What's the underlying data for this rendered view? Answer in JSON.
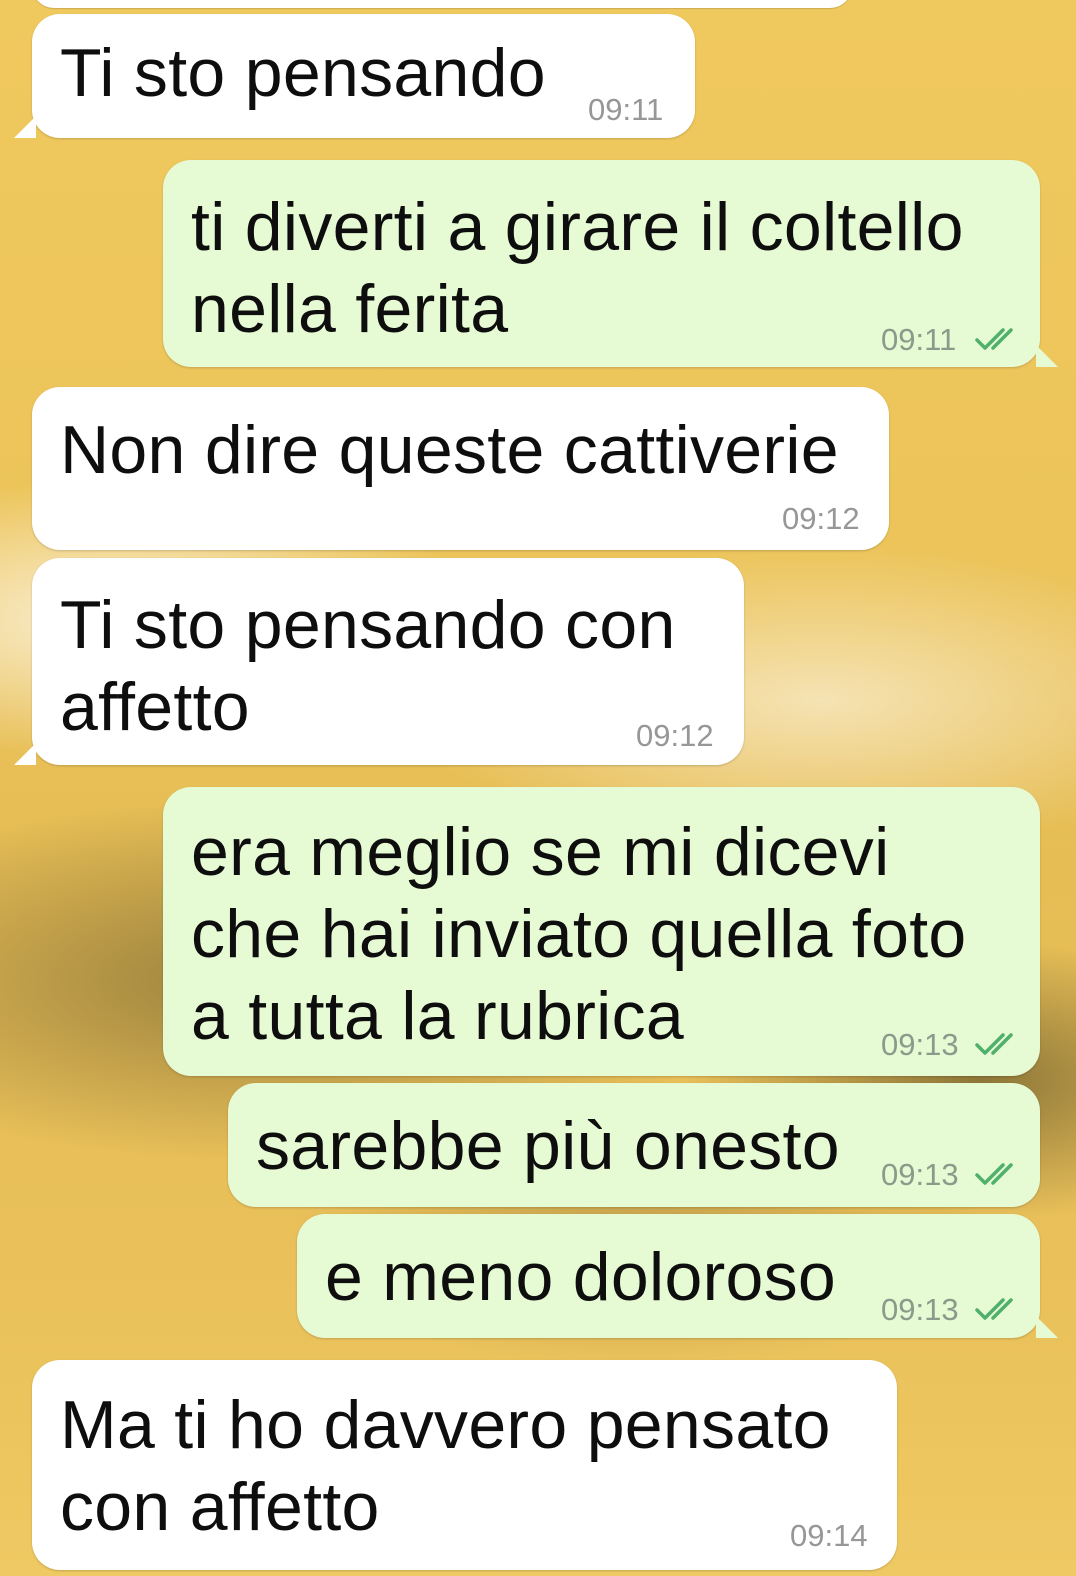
{
  "messages": [
    {
      "text": "Ti sto pensando",
      "time": "09:11",
      "direction": "incoming"
    },
    {
      "text": "ti diverti a girare il coltello\nnella ferita",
      "time": "09:11",
      "direction": "outgoing",
      "status": "read"
    },
    {
      "text": "Non dire queste cattiverie",
      "time": "09:12",
      "direction": "incoming"
    },
    {
      "text": "Ti sto pensando con\naffetto",
      "time": "09:12",
      "direction": "incoming"
    },
    {
      "text": "era meglio se mi dicevi\nche hai inviato quella foto\na tutta la rubrica",
      "time": "09:13",
      "direction": "outgoing",
      "status": "read"
    },
    {
      "text": "sarebbe più onesto",
      "time": "09:13",
      "direction": "outgoing",
      "status": "read"
    },
    {
      "text": "e meno doloroso",
      "time": "09:13",
      "direction": "outgoing",
      "status": "read"
    },
    {
      "text": "Ma ti ho davvero pensato\ncon affetto",
      "time": "09:14",
      "direction": "incoming"
    }
  ],
  "colors": {
    "incoming_bubble": "#ffffff",
    "outgoing_bubble": "#e6fad4",
    "read_ticks": "#4fb06a",
    "wallpaper": "#e9bf55"
  },
  "icons": {
    "read_status": "double-check-icon"
  }
}
